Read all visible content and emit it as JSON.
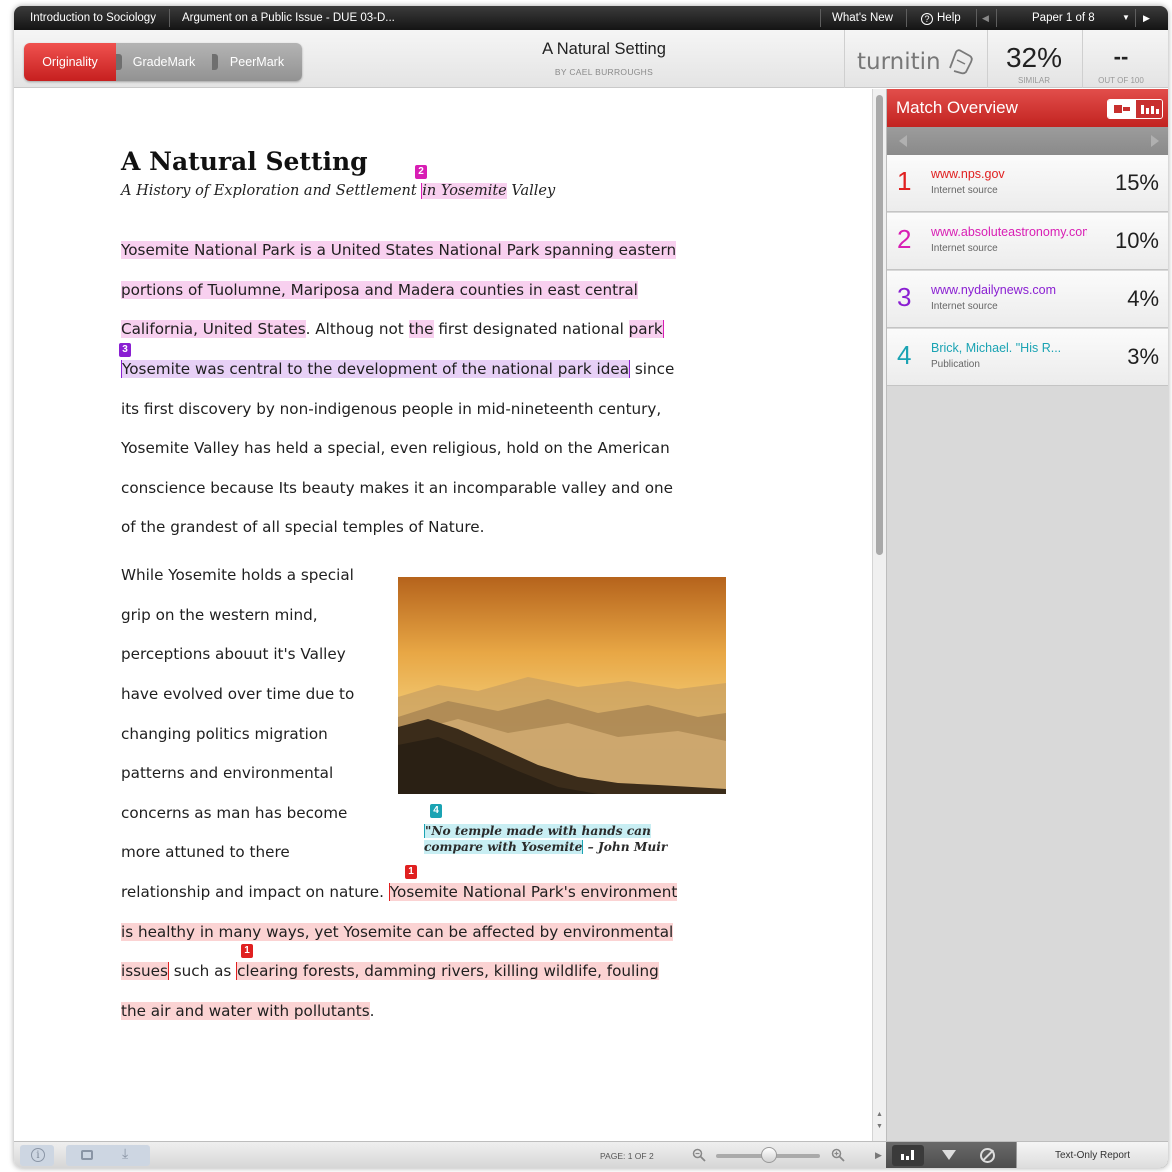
{
  "topbar": {
    "class_name": "Introduction to Sociology",
    "assignment": "Argument on a Public Issue - DUE 03-D...",
    "whats_new": "What's New",
    "help": "Help",
    "paper_counter": "Paper 1 of 8"
  },
  "header": {
    "modes": [
      "Originality",
      "GradeMark",
      "PeerMark"
    ],
    "title": "A Natural Setting",
    "author": "BY CAEL BURROUGHS",
    "brand": "turnitin",
    "similarity": "32%",
    "similarity_label": "SIMILAR",
    "grade": "--",
    "grade_label": "OUT OF 100"
  },
  "document": {
    "title": "A Natural Setting",
    "subtitle_pre": "A History of Exploration and Settlement ",
    "subtitle_match": "in Yosemite",
    "subtitle_post": " Valley",
    "p1": {
      "l1": "Yosemite National Park is a United States National Park spanning eastern",
      "l2": "portions of Tuolumne, Mariposa and Madera counties in east central",
      "l3_a": "California, United States",
      "l3_b": ". Althoug not ",
      "l3_c": "the",
      "l3_d": " first designated national ",
      "l3_e": "park",
      "l4_a": "Yosemite was central to the development of the national park idea",
      "l4_b": " since",
      "l5": "its first discovery by non-indigenous people in mid-nineteenth century,",
      "l6": "Yosemite Valley has held a special, even religious, hold on the American",
      "l7": "conscience because Its beauty makes it an incomparable valley and one",
      "l8": "of the grandest of all special temples of Nature."
    },
    "p2_column": [
      "While Yosemite holds a special",
      "grip on the western mind,",
      "perceptions abouut it's Valley",
      "have evolved over time due to",
      "changing politics migration",
      "patterns and environmental",
      "concerns as man has become",
      "more attuned to there"
    ],
    "p2": {
      "l9_a": "relationship and impact on nature. ",
      "l9_b": "Yosemite National Park's environment",
      "l10": "is healthy in many ways, yet Yosemite can be affected by environmental",
      "l11_a": "issues",
      "l11_b": " such as ",
      "l11_c": "clearing forests, damming rivers, killing wildlife, fouling",
      "l12_a": "the air and water with pollutants",
      "l12_b": "."
    },
    "quote_l1": "\"No temple made with hands can",
    "quote_l2_a": "compare with Yosemite",
    "quote_l2_b": " – John Muir",
    "markers": [
      "1",
      "2",
      "3",
      "4"
    ]
  },
  "panel": {
    "title": "Match Overview",
    "sources": [
      {
        "num": "1",
        "name": "www.nps.gov",
        "type": "Internet source",
        "pct": "15%",
        "color": "#e02020"
      },
      {
        "num": "2",
        "name": "www.absoluteastronomy.com",
        "type": "Internet source",
        "pct": "10%",
        "color": "#d81eb4"
      },
      {
        "num": "3",
        "name": "www.nydailynews.com",
        "type": "Internet source",
        "pct": "4%",
        "color": "#8a1fd2"
      },
      {
        "num": "4",
        "name": "Brick, Michael. \"His R...",
        "type": "Publication",
        "pct": "3%",
        "color": "#1aa3b3"
      }
    ]
  },
  "footer": {
    "page_label": "PAGE:  1 OF 2",
    "text_only": "Text-Only Report"
  },
  "colors": {
    "source1": "#e02020",
    "source2": "#d81eb4",
    "source3": "#8a1fd2",
    "source4": "#1aa3b3",
    "accent": "#c8302e"
  },
  "icons": [
    "help-icon",
    "prev-paper-icon",
    "paper-menu-icon",
    "next-paper-icon",
    "info-icon",
    "print-icon",
    "download-icon",
    "zoom-out-icon",
    "zoom-in-icon",
    "bar-chart-icon",
    "filter-icon",
    "exclude-icon"
  ]
}
